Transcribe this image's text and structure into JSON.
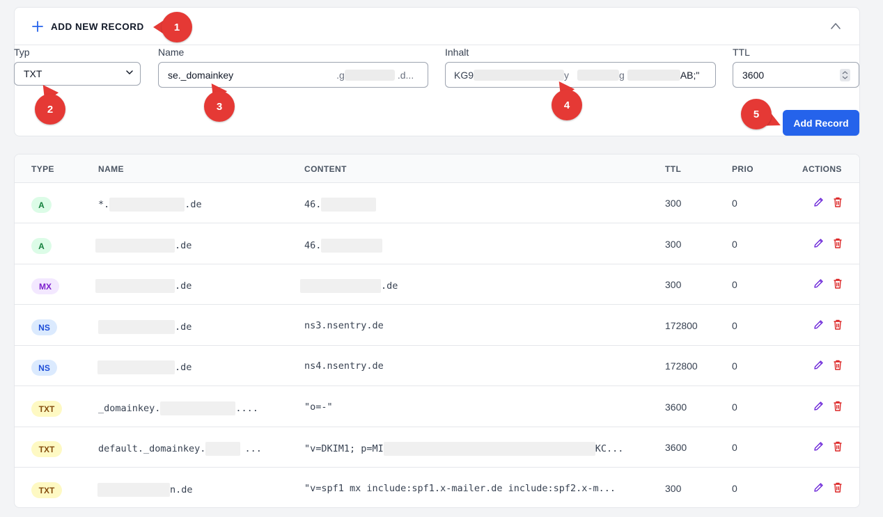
{
  "add_record": {
    "title": "ADD NEW RECORD",
    "fields": {
      "type": {
        "label": "Typ",
        "value": "TXT"
      },
      "name": {
        "label": "Name",
        "value": "se._domainkey",
        "suffix_tail": ".g",
        "suffix_end": ".d..."
      },
      "content": {
        "label": "Inhalt",
        "value_start": "KG9",
        "value_mid": "y",
        "value_mid2": "g",
        "value_end": "AB;\""
      },
      "ttl": {
        "label": "TTL",
        "value": "3600"
      }
    },
    "submit_label": "Add Record"
  },
  "markers": [
    "1",
    "2",
    "3",
    "4",
    "5"
  ],
  "colors": {
    "accent": "#2563eb",
    "marker": "#e53935",
    "edit_icon": "#6d28d9",
    "delete_icon": "#dc2626"
  },
  "table": {
    "columns": [
      "TYPE",
      "NAME",
      "CONTENT",
      "TTL",
      "PRIO",
      "ACTIONS"
    ],
    "rows": [
      {
        "type": "A",
        "name_prefix": "*.",
        "name_suffix": ".de",
        "content_prefix": "46.",
        "content_suffix": "",
        "ttl": "300",
        "prio": "0"
      },
      {
        "type": "A",
        "name_prefix": "",
        "name_suffix": ".de",
        "content_prefix": "46.",
        "content_suffix": "",
        "ttl": "300",
        "prio": "0"
      },
      {
        "type": "MX",
        "name_prefix": "",
        "name_suffix": ".de",
        "content_prefix": "",
        "content_suffix": ".de",
        "ttl": "300",
        "prio": "0"
      },
      {
        "type": "NS",
        "name_prefix": "",
        "name_suffix": ".de",
        "content_prefix": "ns3.nsentry.de",
        "content_suffix": "",
        "ttl": "172800",
        "prio": "0"
      },
      {
        "type": "NS",
        "name_prefix": "",
        "name_suffix": ".de",
        "content_prefix": "ns4.nsentry.de",
        "content_suffix": "",
        "ttl": "172800",
        "prio": "0"
      },
      {
        "type": "TXT",
        "name_prefix": "_domainkey.",
        "name_suffix": "....",
        "content_prefix": "\"o=-\"",
        "content_suffix": "",
        "ttl": "3600",
        "prio": "0"
      },
      {
        "type": "TXT",
        "name_prefix": "default._domainkey.",
        "name_suffix": "...",
        "content_prefix": "\"v=DKIM1; p=MI",
        "content_suffix": "KC...",
        "ttl": "3600",
        "prio": "0"
      },
      {
        "type": "TXT",
        "name_prefix": "",
        "name_suffix": "n.de",
        "content_prefix": "\"v=spf1 mx include:spf1.x-mailer.de include:spf2.x-m...",
        "content_suffix": "",
        "ttl": "300",
        "prio": "0"
      }
    ]
  },
  "icons": {
    "add": "plus-icon",
    "collapse": "chevron-up-icon",
    "edit": "pencil-icon",
    "delete": "trash-icon"
  }
}
